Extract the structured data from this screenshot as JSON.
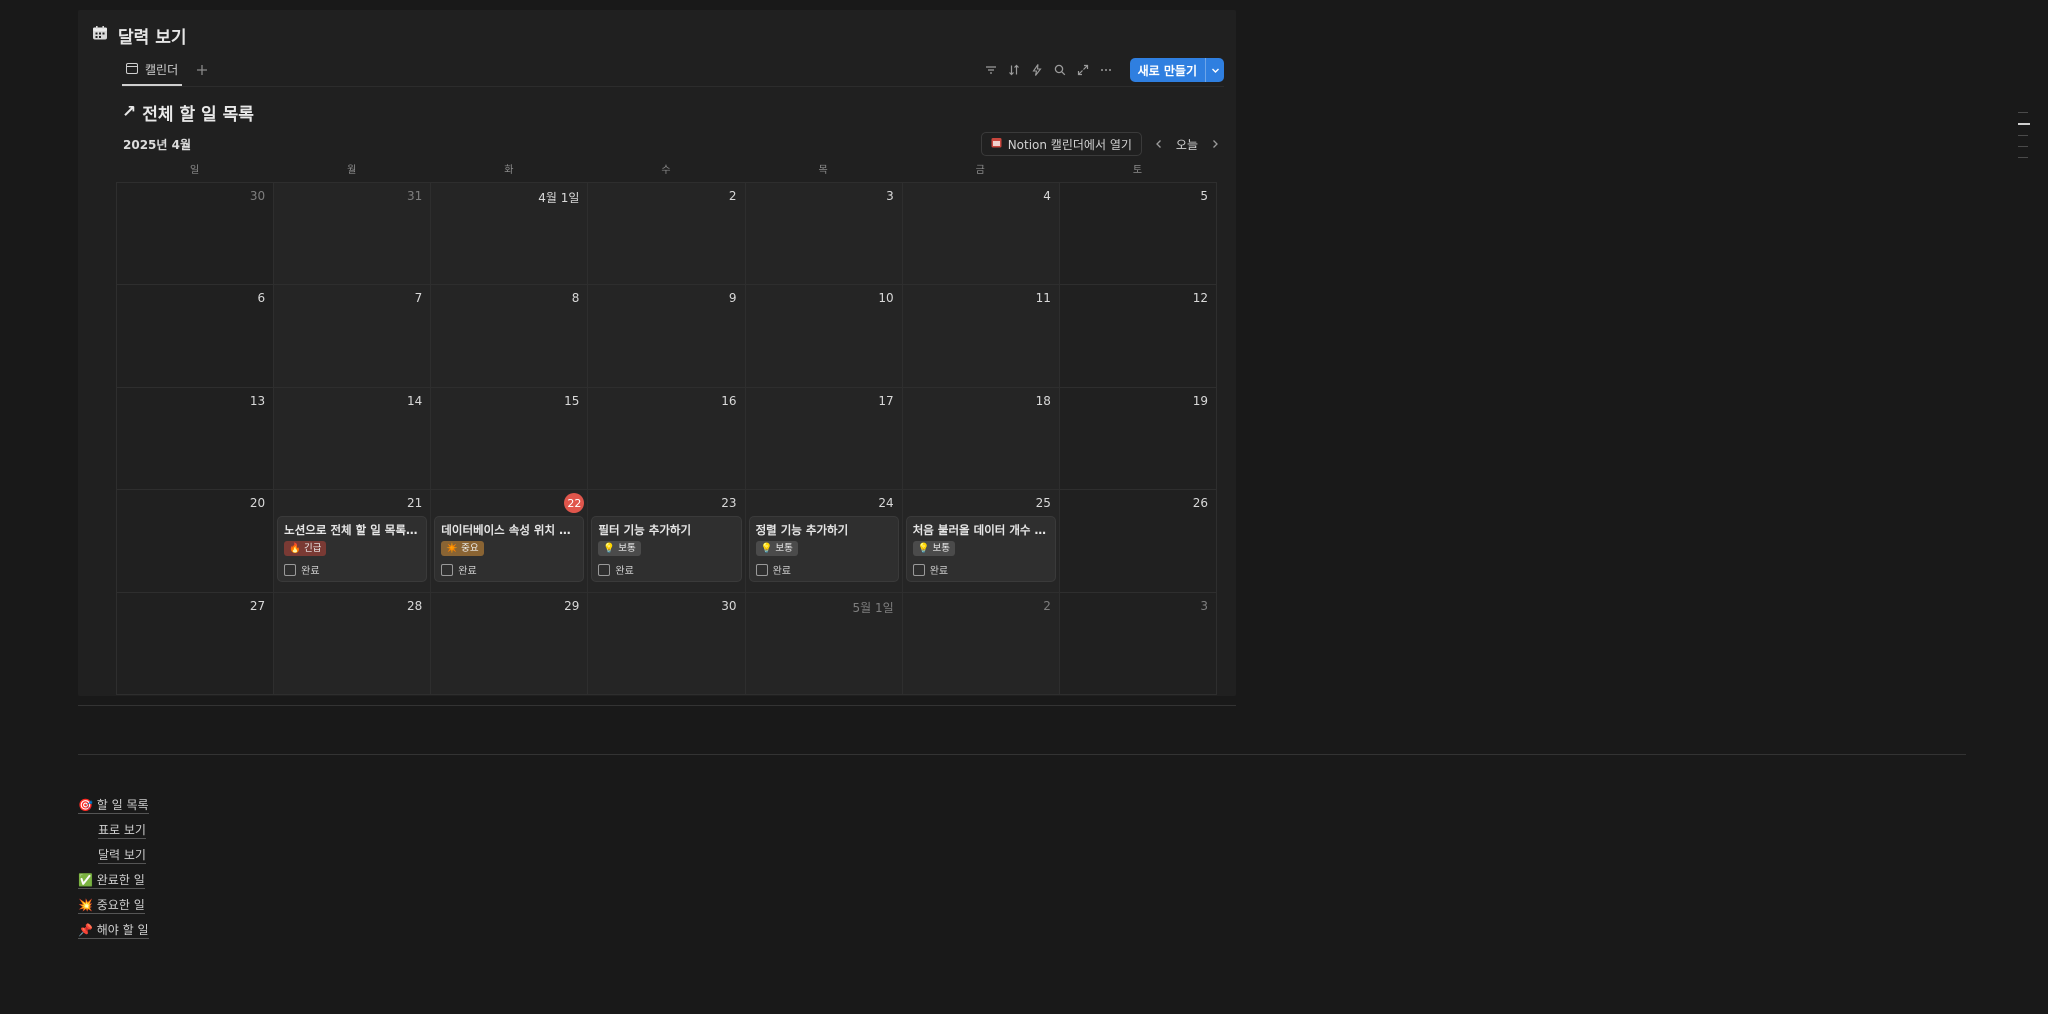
{
  "panel": {
    "title": "달력 보기",
    "title_icon": "calendar-icon"
  },
  "toolbar": {
    "view_tab": "캘린더",
    "new_button": "새로 만들기",
    "icons": [
      "filter-icon",
      "sort-icon",
      "lightning-icon",
      "search-icon",
      "expand-icon",
      "more-icon"
    ]
  },
  "database": {
    "title_prefix": "↗",
    "title": "전체 할 일 목록"
  },
  "calendar": {
    "month_label": "2025년 4월",
    "open_in_notion": "Notion 캘린더에서 열기",
    "today_label": "오늘",
    "weekdays": [
      "일",
      "월",
      "화",
      "수",
      "목",
      "금",
      "토"
    ],
    "days": [
      {
        "label": "30",
        "muted": true
      },
      {
        "label": "31",
        "muted": true
      },
      {
        "label": "4월 1일"
      },
      {
        "label": "2"
      },
      {
        "label": "3"
      },
      {
        "label": "4"
      },
      {
        "label": "5"
      },
      {
        "label": "6"
      },
      {
        "label": "7"
      },
      {
        "label": "8"
      },
      {
        "label": "9"
      },
      {
        "label": "10"
      },
      {
        "label": "11"
      },
      {
        "label": "12"
      },
      {
        "label": "13"
      },
      {
        "label": "14"
      },
      {
        "label": "15"
      },
      {
        "label": "16"
      },
      {
        "label": "17"
      },
      {
        "label": "18"
      },
      {
        "label": "19"
      },
      {
        "label": "20"
      },
      {
        "label": "21"
      },
      {
        "label": "22",
        "today": true
      },
      {
        "label": "23"
      },
      {
        "label": "24"
      },
      {
        "label": "25"
      },
      {
        "label": "26"
      },
      {
        "label": "27"
      },
      {
        "label": "28"
      },
      {
        "label": "29"
      },
      {
        "label": "30"
      },
      {
        "label": "5월 1일",
        "muted": true
      },
      {
        "label": "2",
        "muted": true
      },
      {
        "label": "3",
        "muted": true
      }
    ],
    "events": [
      {
        "day_index": 22,
        "title": "노션으로 전체 할 일 목록 만...",
        "tag": "🔥 긴급",
        "tag_type": "urgent",
        "check": "완료"
      },
      {
        "day_index": 23,
        "title": "데이터베이스 속성 위치 변...",
        "tag": "✴️ 중요",
        "tag_type": "important",
        "check": "완료"
      },
      {
        "day_index": 24,
        "title": "필터 기능 추가하기",
        "tag": "💡 보통",
        "tag_type": "normal",
        "check": "완료"
      },
      {
        "day_index": 25,
        "title": "정렬 기능 추가하기",
        "tag": "💡 보통",
        "tag_type": "normal",
        "check": "완료"
      },
      {
        "day_index": 26,
        "title": "처음 불러올 데이터 개수 지...",
        "tag": "💡 보통",
        "tag_type": "normal",
        "check": "완료"
      }
    ]
  },
  "subnav": [
    {
      "label": "🎯 할 일 목록",
      "sub": false
    },
    {
      "label": "표로 보기",
      "sub": true
    },
    {
      "label": "달력 보기",
      "sub": true
    },
    {
      "label": "✅ 완료한 일",
      "sub": false
    },
    {
      "label": "💥 중요한 일",
      "sub": false
    },
    {
      "label": "📌 해야 할 일",
      "sub": false
    }
  ]
}
